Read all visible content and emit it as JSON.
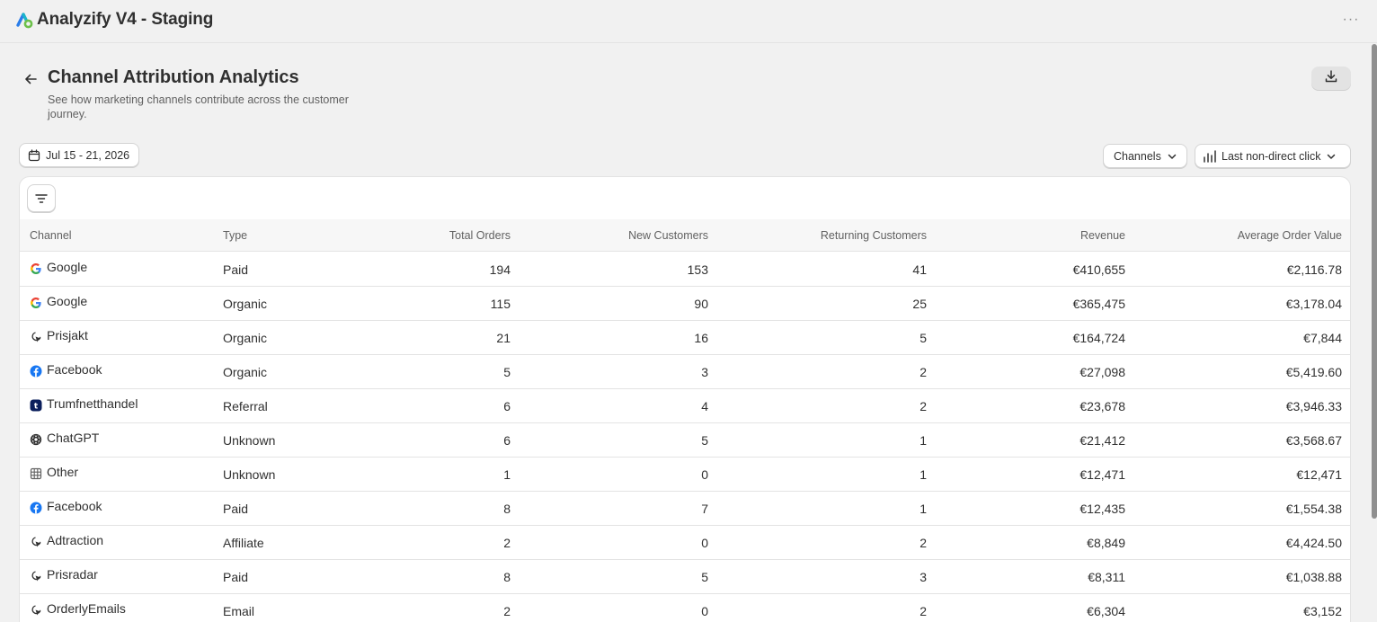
{
  "app": {
    "title": "Analyzify V4 - Staging",
    "more_label": "···"
  },
  "page": {
    "title": "Channel Attribution Analytics",
    "subtitle": "See how marketing channels contribute across the customer journey."
  },
  "controls": {
    "date_range": "Jul 15 - 21, 2026",
    "group_by": "Channels",
    "attribution_model": "Last non-direct click"
  },
  "table": {
    "columns": [
      "Channel",
      "Type",
      "Total Orders",
      "New Customers",
      "Returning Customers",
      "Revenue",
      "Average Order Value"
    ],
    "rows": [
      {
        "icon": "google-icon",
        "channel": "Google",
        "type": "Paid",
        "total_orders": "194",
        "new_customers": "153",
        "returning_customers": "41",
        "revenue": "€410,655",
        "aov": "€2,116.78"
      },
      {
        "icon": "google-icon",
        "channel": "Google",
        "type": "Organic",
        "total_orders": "115",
        "new_customers": "90",
        "returning_customers": "25",
        "revenue": "€365,475",
        "aov": "€3,178.04"
      },
      {
        "icon": "click-cursor-icon",
        "channel": "Prisjakt",
        "type": "Organic",
        "total_orders": "21",
        "new_customers": "16",
        "returning_customers": "5",
        "revenue": "€164,724",
        "aov": "€7,844"
      },
      {
        "icon": "facebook-icon",
        "channel": "Facebook",
        "type": "Organic",
        "total_orders": "5",
        "new_customers": "3",
        "returning_customers": "2",
        "revenue": "€27,098",
        "aov": "€5,419.60"
      },
      {
        "icon": "trumf-icon",
        "channel": "Trumfnetthandel",
        "type": "Referral",
        "total_orders": "6",
        "new_customers": "4",
        "returning_customers": "2",
        "revenue": "€23,678",
        "aov": "€3,946.33"
      },
      {
        "icon": "chatgpt-icon",
        "channel": "ChatGPT",
        "type": "Unknown",
        "total_orders": "6",
        "new_customers": "5",
        "returning_customers": "1",
        "revenue": "€21,412",
        "aov": "€3,568.67"
      },
      {
        "icon": "grid-icon",
        "channel": "Other",
        "type": "Unknown",
        "total_orders": "1",
        "new_customers": "0",
        "returning_customers": "1",
        "revenue": "€12,471",
        "aov": "€12,471"
      },
      {
        "icon": "facebook-icon",
        "channel": "Facebook",
        "type": "Paid",
        "total_orders": "8",
        "new_customers": "7",
        "returning_customers": "1",
        "revenue": "€12,435",
        "aov": "€1,554.38"
      },
      {
        "icon": "click-cursor-icon",
        "channel": "Adtraction",
        "type": "Affiliate",
        "total_orders": "2",
        "new_customers": "0",
        "returning_customers": "2",
        "revenue": "€8,849",
        "aov": "€4,424.50"
      },
      {
        "icon": "click-cursor-icon",
        "channel": "Prisradar",
        "type": "Paid",
        "total_orders": "8",
        "new_customers": "5",
        "returning_customers": "3",
        "revenue": "€8,311",
        "aov": "€1,038.88"
      },
      {
        "icon": "click-cursor-icon",
        "channel": "OrderlyEmails",
        "type": "Email",
        "total_orders": "2",
        "new_customers": "0",
        "returning_customers": "2",
        "revenue": "€6,304",
        "aov": "€3,152"
      }
    ]
  }
}
